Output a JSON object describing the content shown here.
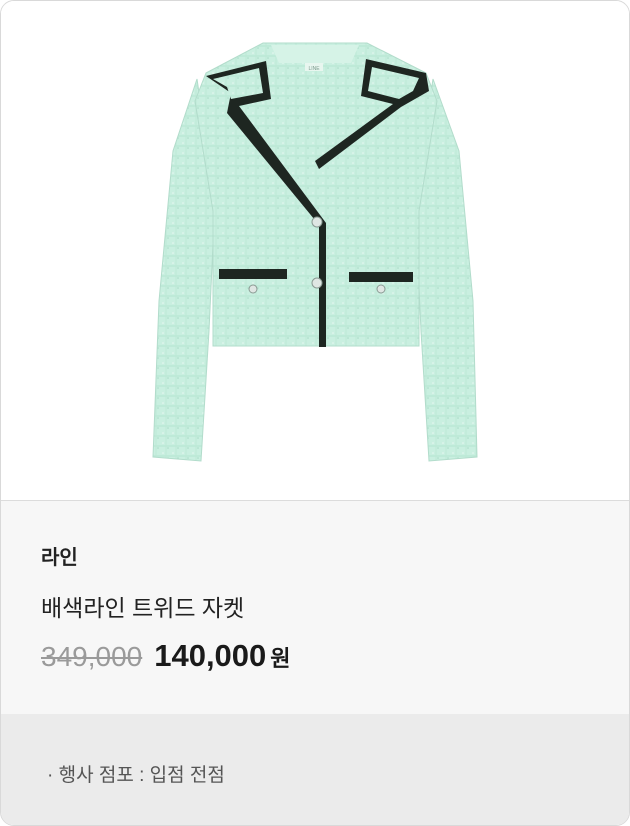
{
  "product": {
    "brand": "라인",
    "name": "배색라인 트위드 자켓",
    "original_price": "349,000",
    "sale_price": "140,000",
    "currency": "원",
    "store_info": "· 행사 점포 : 입점 전점",
    "jacket_label": "LINE",
    "colors": {
      "jacket": "#c9efe0",
      "trim": "#1e2621",
      "lining": "#a9e3cc"
    }
  }
}
